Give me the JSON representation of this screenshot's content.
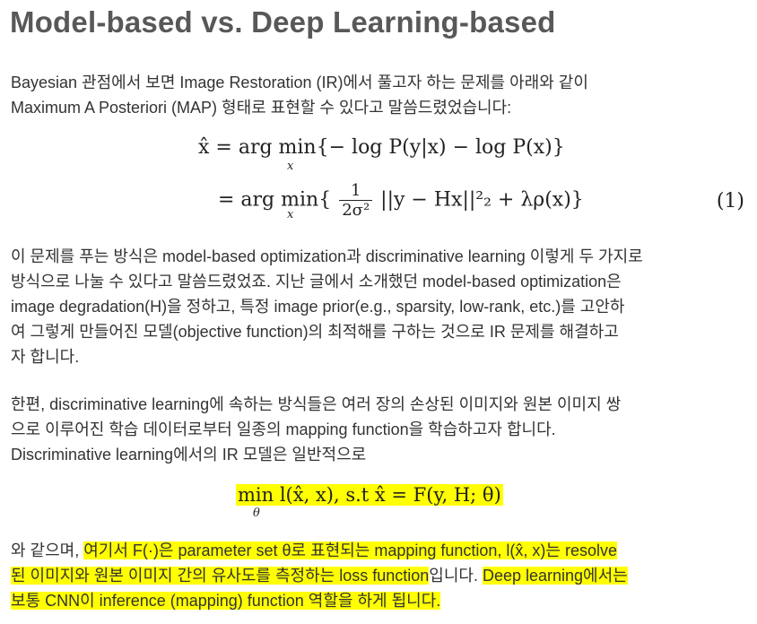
{
  "title": "Model-based vs. Deep Learning-based",
  "intro": {
    "line1": "Bayesian 관점에서 보면 Image Restoration (IR)에서 풀고자 하는 문제를 아래와 같이",
    "line2": "Maximum A Posteriori (MAP) 형태로 표현할 수 있다고 말씀드렸었습니다:"
  },
  "equation1": {
    "row1": "x̂ = arg min{− log P(y|x) − log P(x)}",
    "row1_sub": "x",
    "row2_left": "= arg min{",
    "row2_sub": "x",
    "frac_num": "1",
    "frac_den": "2σ²",
    "row2_right": "||y − Hx||²₂ + λρ(x)}",
    "number": "(1)"
  },
  "para2": {
    "lines": [
      "이 문제를 푸는 방식은 model-based optimization과 discriminative learning 이렇게 두 가지로",
      "방식으로 나눌 수 있다고 말씀드렸었죠. 지난 글에서 소개했던 model-based optimization은",
      "image degradation(H)을 정하고, 특정 image prior(e.g., sparsity, low-rank, etc.)를 고안하",
      "여 그렇게 만들어진 모델(objective function)의 최적해를 구하는 것으로 IR 문제를 해결하고",
      "자 합니다."
    ]
  },
  "para3": {
    "lines": [
      "한편, discriminative learning에 속하는 방식들은 여러 장의 손상된 이미지와 원본 이미지 쌍",
      "으로 이루어진 학습 데이터로부터 일종의 mapping function을 학습하고자 합니다.",
      "Discriminative learning에서의 IR 모델은 일반적으로"
    ]
  },
  "equation2": {
    "text": "min l(x̂, x),  s.t x̂ = F(y, H; θ)",
    "sub": "θ"
  },
  "para4": {
    "l1_plain": "와 같으며, ",
    "l1_hl": "여기서 F(·)은 parameter set θ로 표현되는 mapping function, l(x̂, x)는 resolve",
    "l2_hl": "된 이미지와 원본 이미지 간의 유사도를 측정하는 loss function",
    "l2_plain": "입니다. ",
    "l2_hl2": "Deep learning에서는",
    "l3_hl": "보통 CNN이 inference (mapping) function 역할을 하게 됩니다."
  },
  "colors": {
    "title": "#585858",
    "text": "#333333",
    "highlight": "#ffff00"
  }
}
